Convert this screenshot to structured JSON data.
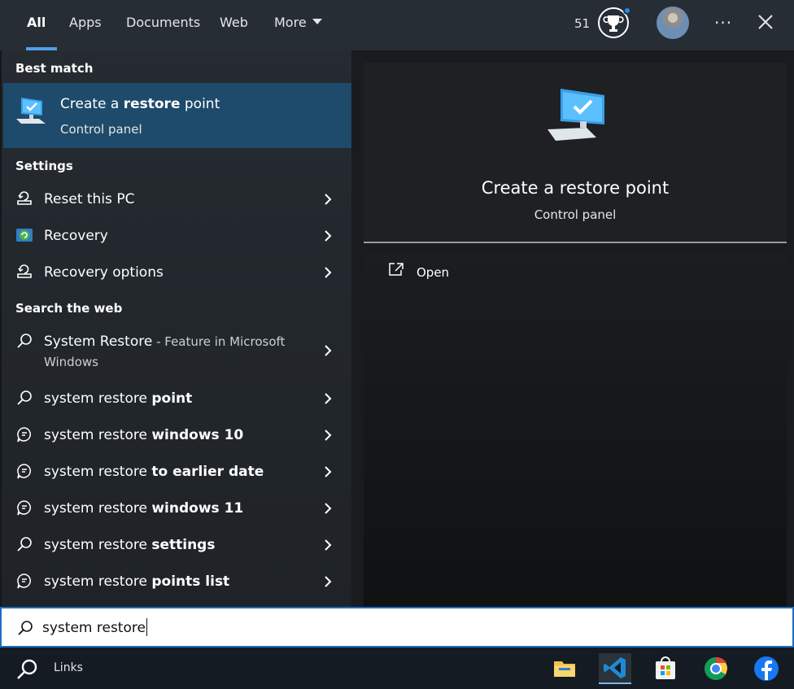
{
  "tabs": [
    "All",
    "Apps",
    "Documents",
    "Web",
    "More"
  ],
  "header": {
    "points": "51",
    "more_icon": "more-dots-icon",
    "close_icon": "close-icon"
  },
  "left": {
    "best_match_heading": "Best match",
    "best_match": {
      "title_pre": "Create a ",
      "title_bold": "restore",
      "title_post": " point",
      "subtitle": "Control panel",
      "icon": "monitor-check-icon"
    },
    "settings_heading": "Settings",
    "settings": [
      {
        "label": "Reset this PC",
        "icon": "reset-pc-icon"
      },
      {
        "label": "Recovery",
        "icon": "recovery-icon"
      },
      {
        "label": "Recovery options",
        "icon": "recovery-options-icon"
      }
    ],
    "web_heading": "Search the web",
    "web_first": {
      "label": "System Restore",
      "desc_line1": " - Feature in Microsoft",
      "desc_line2": "Windows"
    },
    "web": [
      {
        "pre": "system restore ",
        "bold": "point",
        "icon": "search-icon"
      },
      {
        "pre": "system restore ",
        "bold": "windows 10",
        "icon": "chat-icon"
      },
      {
        "pre": "system restore ",
        "bold": "to earlier date",
        "icon": "chat-icon"
      },
      {
        "pre": "system restore ",
        "bold": "windows 11",
        "icon": "chat-icon"
      },
      {
        "pre": "system restore ",
        "bold": "settings",
        "icon": "search-icon"
      },
      {
        "pre": "system restore ",
        "bold": "points list",
        "icon": "chat-icon"
      }
    ]
  },
  "right": {
    "title": "Create a restore point",
    "subtitle": "Control panel",
    "open_label": "Open"
  },
  "search": {
    "value": "system restore"
  },
  "taskbar": {
    "links_label": "Links",
    "apps": [
      "file-explorer-icon",
      "vscode-icon",
      "store-icon",
      "chrome-icon",
      "facebook-icon"
    ]
  },
  "colors": {
    "accent": "#4f9fea",
    "selection": "#1e4a6b",
    "search_border": "#1b6ec2"
  }
}
